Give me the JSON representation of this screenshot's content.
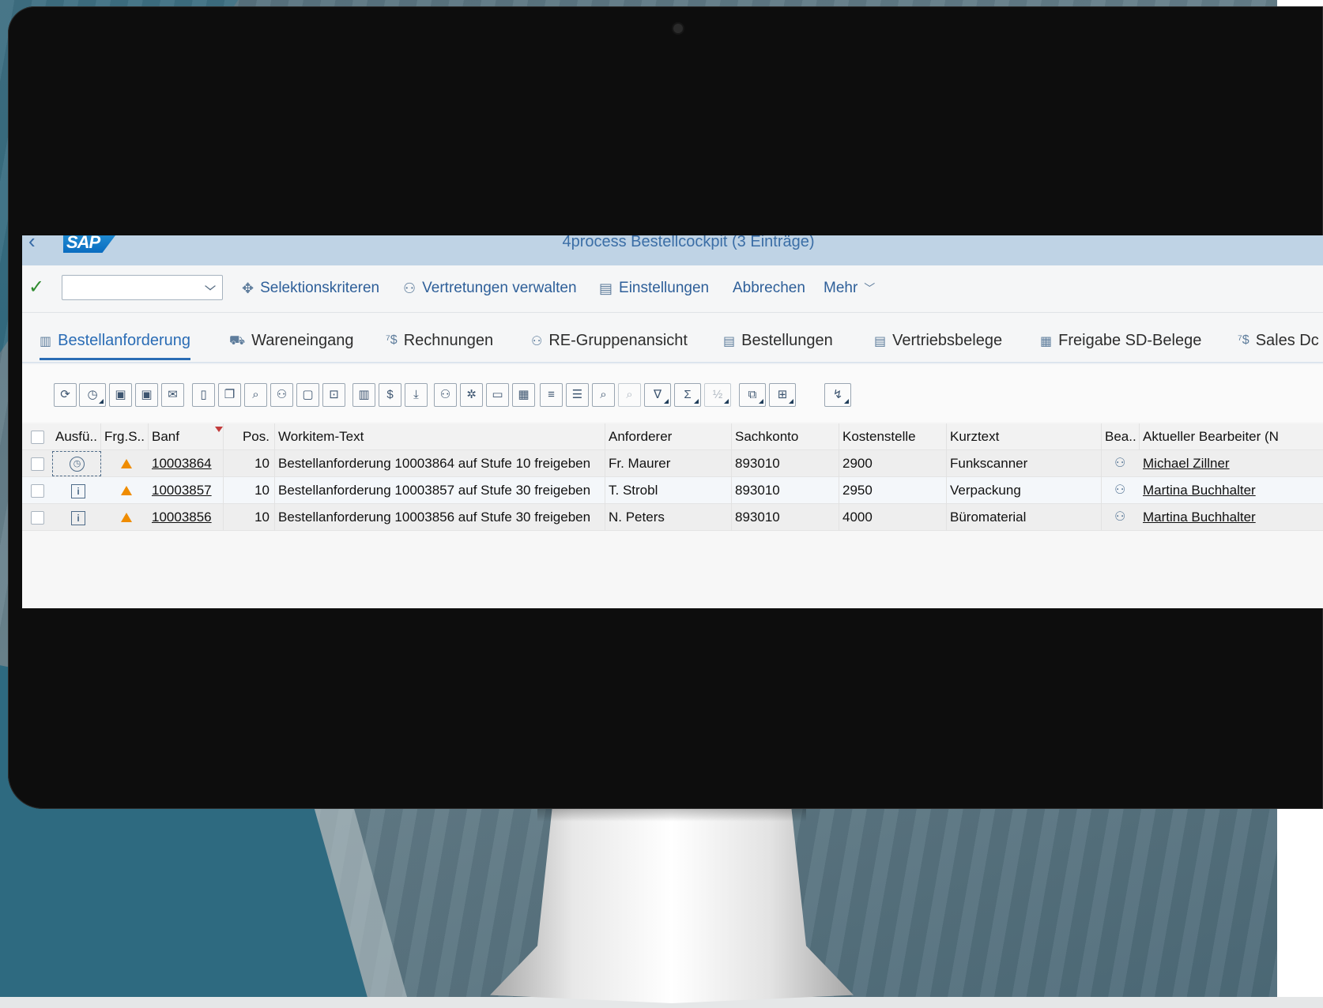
{
  "shell": {
    "back_icon": "back-chevron-icon",
    "logo_text": "SAP",
    "title": "4process Bestellcockpit (3 Einträge)"
  },
  "toolbar": {
    "command_field_value": "",
    "buttons": [
      {
        "label": "Selektionskriteren",
        "icon": "selection-criteria-icon"
      },
      {
        "label": "Vertretungen verwalten",
        "icon": "people-icon"
      },
      {
        "label": "Einstellungen",
        "icon": "settings-document-icon"
      },
      {
        "label": "Abbrechen",
        "icon": ""
      },
      {
        "label": "Mehr",
        "icon": "chevron-down-icon"
      }
    ]
  },
  "tabs": [
    {
      "label": "Bestellanforderung",
      "icon": "document-icon",
      "active": true
    },
    {
      "label": "Wareneingang",
      "icon": "truck-icon",
      "active": false
    },
    {
      "label": "Rechnungen",
      "icon": "invoice-icon",
      "active": false
    },
    {
      "label": "RE-Gruppenansicht",
      "icon": "group-icon",
      "active": false
    },
    {
      "label": "Bestellungen",
      "icon": "order-icon",
      "active": false
    },
    {
      "label": "Vertriebsbelege",
      "icon": "sales-document-icon",
      "active": false
    },
    {
      "label": "Freigabe SD-Belege",
      "icon": "calendar-icon",
      "active": false
    },
    {
      "label": "Sales Dc",
      "icon": "invoice-icon",
      "active": false
    }
  ],
  "table": {
    "columns": [
      "Ausfü..",
      "Frg.S..",
      "Banf",
      "Pos.",
      "Workitem-Text",
      "Anforderer",
      "Sachkonto",
      "Kostenstelle",
      "Kurztext",
      "Bea..",
      "Aktueller Bearbeiter (N"
    ],
    "rows": [
      {
        "status_icon": "clock-icon",
        "banf": "10003864",
        "pos": "10",
        "text": "Bestellanforderung 10003864 auf Stufe 10 freigeben",
        "anforderer": "Fr. Maurer",
        "sachkonto": "893010",
        "kostenstelle": "2900",
        "kurztext": "Funkscanner",
        "bearbeiter": "Michael Zillner"
      },
      {
        "status_icon": "info-icon",
        "banf": "10003857",
        "pos": "10",
        "text": "Bestellanforderung 10003857 auf Stufe 30 freigeben",
        "anforderer": "T. Strobl",
        "sachkonto": "893010",
        "kostenstelle": "2950",
        "kurztext": "Verpackung",
        "bearbeiter": "Martina Buchhalter"
      },
      {
        "status_icon": "info-icon",
        "banf": "10003856",
        "pos": "10",
        "text": "Bestellanforderung 10003856 auf Stufe 30 freigeben",
        "anforderer": "N. Peters",
        "sachkonto": "893010",
        "kostenstelle": "4000",
        "kurztext": "Büromaterial",
        "bearbeiter": "Martina Buchhalter"
      }
    ]
  },
  "colors": {
    "shell_header": "#bfd3e5",
    "link_blue": "#2e5f99",
    "active_tab": "#2a6cb5",
    "warning": "#ef8c00",
    "ok_green": "#2f8b2f"
  }
}
